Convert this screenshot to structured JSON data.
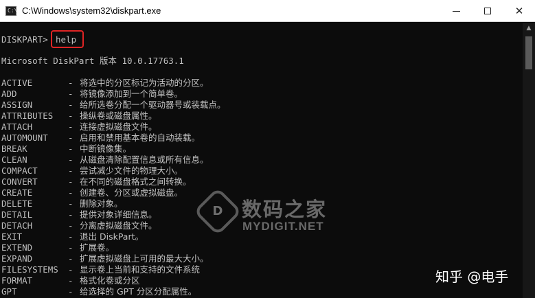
{
  "window": {
    "title": "C:\\Windows\\system32\\diskpart.exe",
    "icon": "console-icon",
    "icon_glyph": "C:\\",
    "controls": {
      "minimize": "minimize-icon",
      "maximize": "maximize-icon",
      "close": "✕"
    }
  },
  "console": {
    "prompt": "DISKPART>",
    "command": "help",
    "version_line": "Microsoft DiskPart 版本 10.0.17763.1",
    "commands": [
      {
        "name": "ACTIVE",
        "desc": "将选中的分区标记为活动的分区。"
      },
      {
        "name": "ADD",
        "desc": "将镜像添加到一个简单卷。"
      },
      {
        "name": "ASSIGN",
        "desc": "给所选卷分配一个驱动器号或装载点。"
      },
      {
        "name": "ATTRIBUTES",
        "desc": "操纵卷或磁盘属性。"
      },
      {
        "name": "ATTACH",
        "desc": "连接虚拟磁盘文件。"
      },
      {
        "name": "AUTOMOUNT",
        "desc": "启用和禁用基本卷的自动装载。"
      },
      {
        "name": "BREAK",
        "desc": "中断镜像集。"
      },
      {
        "name": "CLEAN",
        "desc": "从磁盘清除配置信息或所有信息。"
      },
      {
        "name": "COMPACT",
        "desc": "尝试减少文件的物理大小。"
      },
      {
        "name": "CONVERT",
        "desc": "在不同的磁盘格式之间转换。"
      },
      {
        "name": "CREATE",
        "desc": "创建卷、分区或虚拟磁盘。"
      },
      {
        "name": "DELETE",
        "desc": "删除对象。"
      },
      {
        "name": "DETAIL",
        "desc": "提供对象详细信息。"
      },
      {
        "name": "DETACH",
        "desc": "分离虚拟磁盘文件。"
      },
      {
        "name": "EXIT",
        "desc": "退出 DiskPart。"
      },
      {
        "name": "EXTEND",
        "desc": "扩展卷。"
      },
      {
        "name": "EXPAND",
        "desc": "扩展虚拟磁盘上可用的最大大小。"
      },
      {
        "name": "FILESYSTEMS",
        "desc": "显示卷上当前和支持的文件系统"
      },
      {
        "name": "FORMAT",
        "desc": "格式化卷或分区"
      },
      {
        "name": "GPT",
        "desc": "给选择的 GPT 分区分配属性。"
      }
    ],
    "dash": "-"
  },
  "watermark": {
    "logo_glyph": "D",
    "site_cn": "数码之家",
    "site_en": "MYDIGIT.NET",
    "zhihu": "知乎 @电手"
  },
  "colors": {
    "console_bg": "#0c0c0c",
    "console_fg": "#c0c0c0",
    "highlight": "#e02424"
  }
}
